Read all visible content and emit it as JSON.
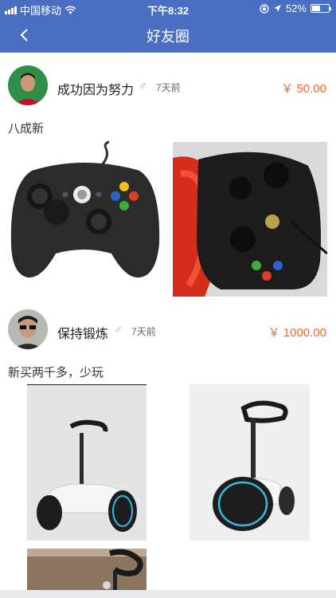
{
  "status_bar": {
    "carrier": "中国移动",
    "time": "下午8:32",
    "battery_percent": "52%",
    "battery_level": 0.52,
    "icons": [
      "signal-icon",
      "wifi-icon",
      "lock-rotation-icon",
      "location-arrow-icon",
      "battery-icon"
    ]
  },
  "nav": {
    "title": "好友圈",
    "back_icon": "chevron-left-icon"
  },
  "colors": {
    "nav_bar": "#4a6fc2",
    "price": "#ee6a2a",
    "gender_male": "#59b7e8"
  },
  "posts": [
    {
      "username": "成功因为努力",
      "gender_symbol": "♂",
      "time": "7天前",
      "price": "￥ 50.00",
      "text": "八成新",
      "images": [
        "black-xbox-controller-photo",
        "black-controller-on-red-cloth-photo"
      ]
    },
    {
      "username": "保持锻炼",
      "gender_symbol": "♂",
      "time": "7天前",
      "price": "￥ 1000.00",
      "text": "新买两千多，少玩",
      "images": [
        "white-self-balancing-scooter-photo",
        "white-balancing-scooter-rear-photo",
        "scooter-handlebar-photo"
      ]
    }
  ]
}
